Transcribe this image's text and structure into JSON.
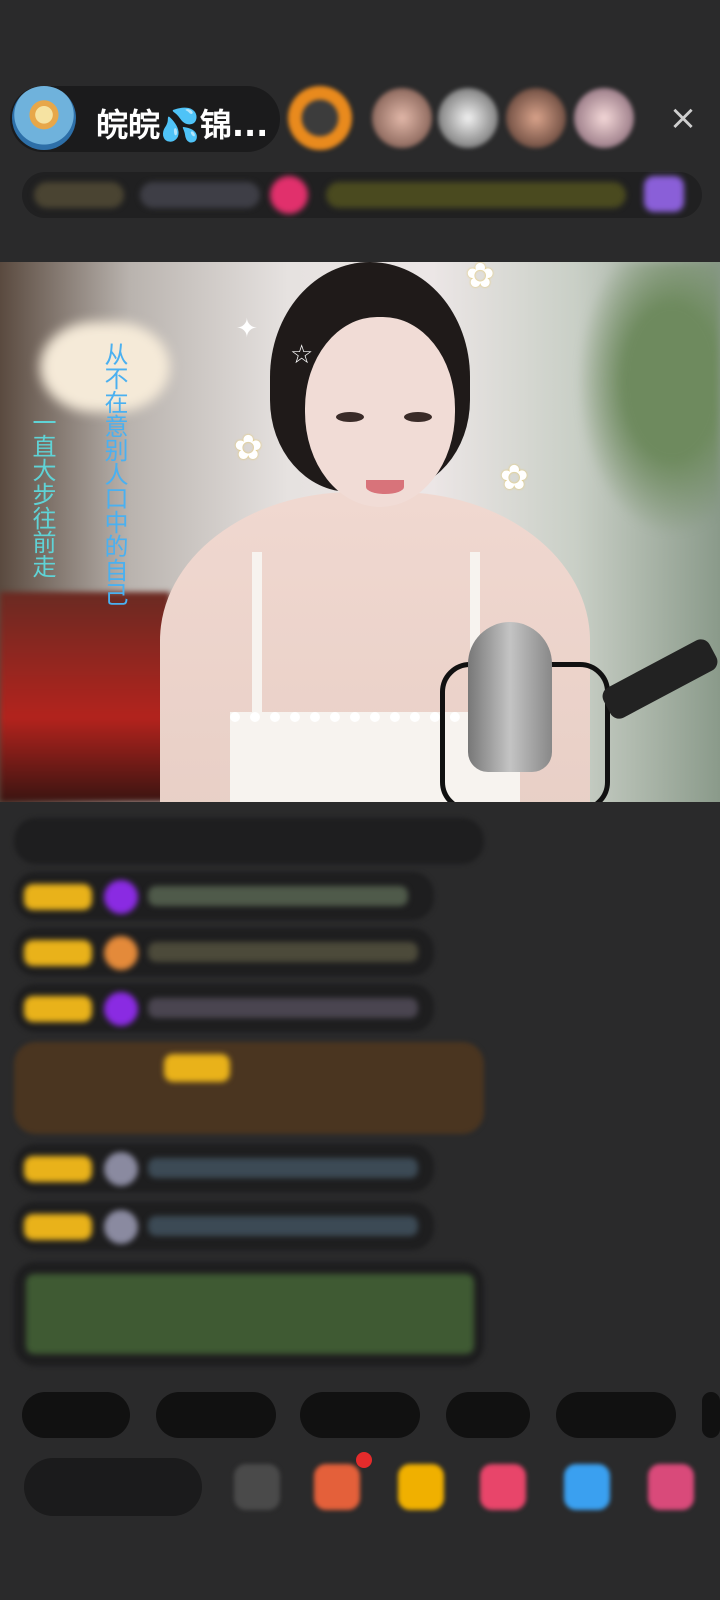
{
  "header": {
    "host_name": "皖皖💦锦...",
    "close_symbol": "×"
  },
  "video": {
    "caption_left": "一直大步往前走",
    "caption_right": "从不在意别人口中的自己"
  },
  "colors": {
    "background": "#2a2a2b",
    "caption_left": "#5fd3d6",
    "caption_right": "#4ab0f0",
    "badge_gold": "#e9b21a"
  },
  "icons": [
    "close-icon",
    "gift-icon",
    "star-icon",
    "daisy-icon"
  ]
}
